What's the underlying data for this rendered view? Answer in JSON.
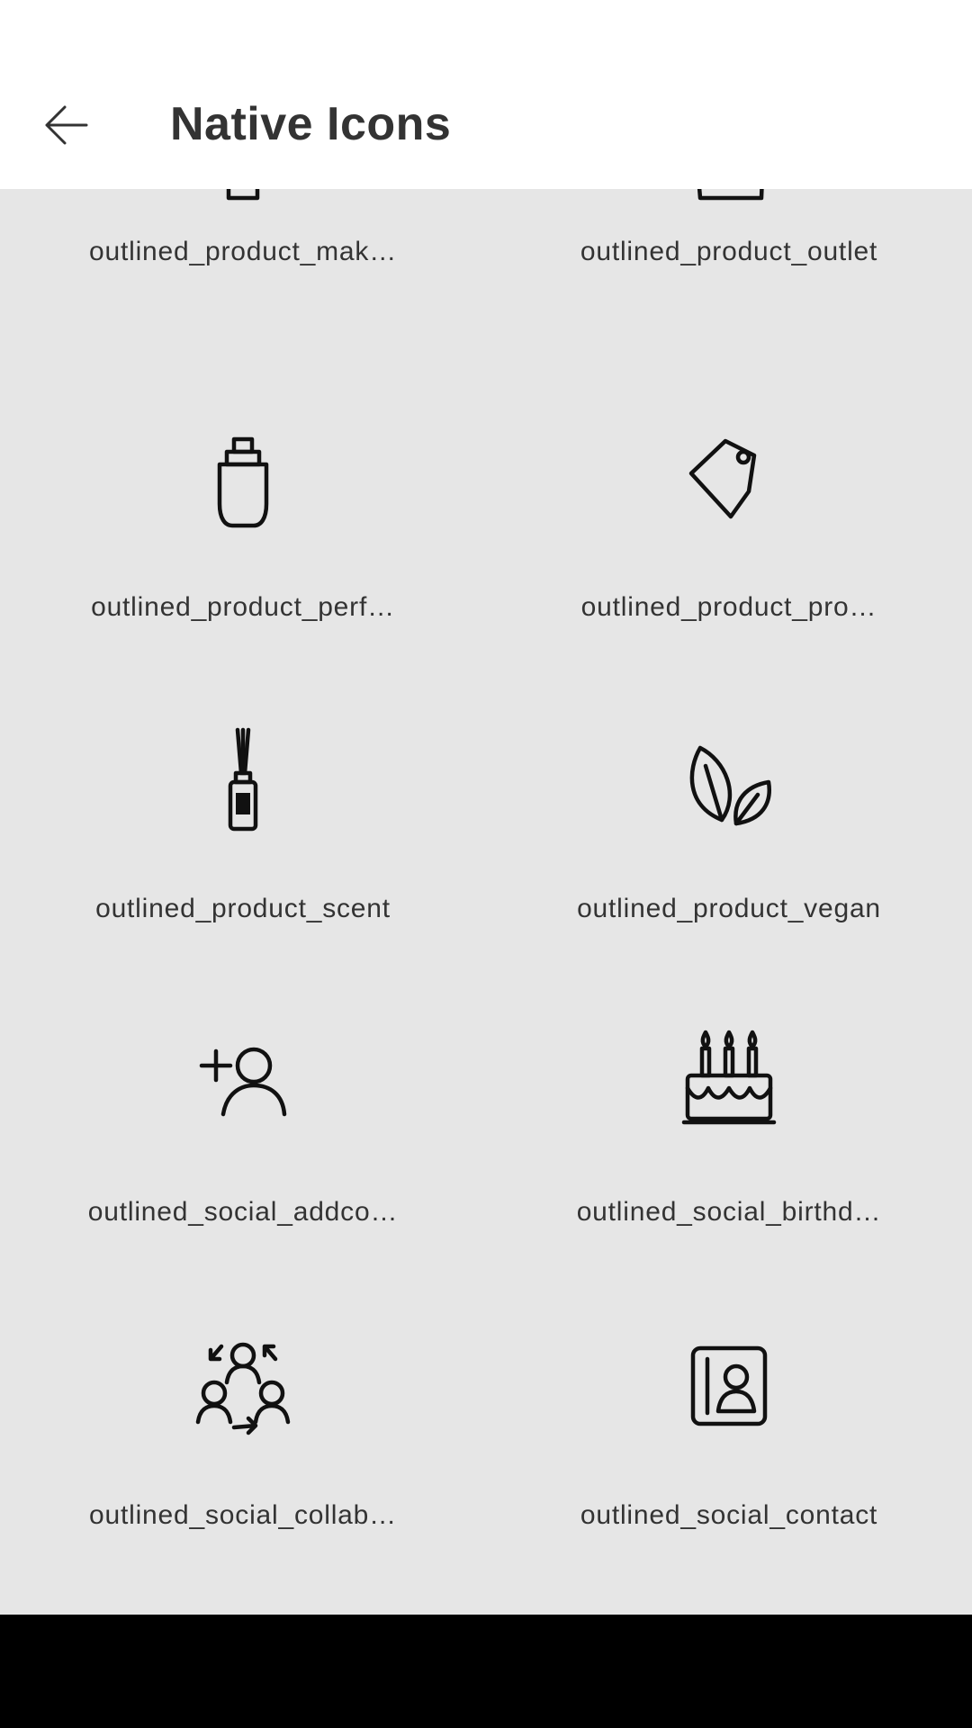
{
  "app_bar": {
    "title": "Native Icons",
    "back_icon": "arrow-back-icon"
  },
  "icons": [
    {
      "label": "outlined_product_mak…",
      "icon": "product-makeup-icon"
    },
    {
      "label": "outlined_product_outlet",
      "icon": "product-outlet-icon"
    },
    {
      "label": "outlined_product_perf…",
      "icon": "product-perfume-icon"
    },
    {
      "label": "outlined_product_pro…",
      "icon": "product-promo-tag-icon"
    },
    {
      "label": "outlined_product_scent",
      "icon": "product-scent-diffuser-icon"
    },
    {
      "label": "outlined_product_vegan",
      "icon": "product-vegan-leaves-icon"
    },
    {
      "label": "outlined_social_addco…",
      "icon": "social-add-contact-icon"
    },
    {
      "label": "outlined_social_birthd…",
      "icon": "social-birthday-cake-icon"
    },
    {
      "label": "outlined_social_collab…",
      "icon": "social-collaboration-icon"
    },
    {
      "label": "outlined_social_contact",
      "icon": "social-contact-card-icon"
    }
  ],
  "colors": {
    "app_bar_bg": "#ffffff",
    "content_bg": "#e6e6e6",
    "text": "#333333",
    "icon_stroke": "#111111",
    "nav_bar_bg": "#000000"
  }
}
